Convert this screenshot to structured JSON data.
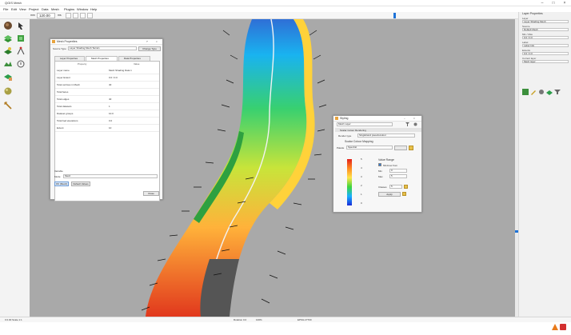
{
  "window": {
    "title": "QGIS Mesh"
  },
  "menu": [
    "File",
    "Edit",
    "View",
    "Project",
    "Data",
    "Mesh",
    "Plugins",
    "Window",
    "Help"
  ],
  "toolbar": {
    "value": "120.00",
    "left_label": "mm",
    "unit_label": "ms"
  },
  "right_panel": {
    "title": "Layer Properties",
    "fields": [
      {
        "label": "Layer",
        "value": "Layer Shading Mesh"
      },
      {
        "label": "Source",
        "value": "Default Mesh"
      },
      {
        "label": "Min / Max",
        "value": "0.0 / 0.0"
      },
      {
        "label": "Label",
        "value": "Label Info"
      },
      {
        "label": "Extents",
        "value": "0.0 / 0.0"
      },
      {
        "label": "Current layer",
        "value": "Mesh layer"
      }
    ]
  },
  "properties_dialog": {
    "title": "Mesh Properties",
    "source_label": "Source Type",
    "source_value": "Layer Shading Mesh Terrain",
    "change_button": "Change Type",
    "tabs": [
      "Layer Properties",
      "Mesh Properties",
      "Data Properties"
    ],
    "col_property": "Property",
    "col_value": "Value",
    "rows": [
      {
        "k": "Layer name",
        "v": "Mesh Shading Data 1"
      },
      {
        "k": "Layer Extent",
        "v": "0.0 / 0.0"
      },
      {
        "k": "Total vertices in Mesh",
        "v": "40"
      },
      {
        "k": "Total faces",
        "v": ""
      },
      {
        "k": "Total edges",
        "v": "40"
      },
      {
        "k": "Total datasets",
        "v": "1"
      },
      {
        "k": "Dataset groups",
        "v": "10.0"
      },
      {
        "k": "Total bed elevations",
        "v": "0.0"
      },
      {
        "k": "Extent",
        "v": "10"
      }
    ],
    "bottom_label": "Variable",
    "mode_label": "Mode",
    "mode_value": "Mesh",
    "btn_ok": "OK (Mesh)",
    "btn_cancel": "Default Values",
    "btn_close": "Close"
  },
  "styling_dialog": {
    "title": "Styling",
    "layer_value": "Mesh Layer",
    "section_title": "Scalar Colour Rendering",
    "type_label": "Render type",
    "type_value": "Singleband pseudocolour",
    "heading": "Scalar Colour Mapping",
    "ramp_label": "Palette",
    "ramp_value": "Spectral",
    "range_title": "Value Range",
    "min_check_label": "Min/max from",
    "min_label": "Min",
    "min_value": "0",
    "max_label": "Max",
    "max_value": "5",
    "classes_label": "Classes",
    "classes_value": "5",
    "apply_button": "Apply",
    "ticks": [
      "5",
      "4",
      "3",
      "2",
      "1",
      "0"
    ],
    "colors": [
      "#e3201c",
      "#ff8a1f",
      "#ffe34a",
      "#3dd63d",
      "#17b0ff",
      "#1b2bd8"
    ]
  },
  "status": {
    "coordinate": "0 0.00 Scale 1:1",
    "rotation": "Rotation 0.0",
    "magnifier": "100%",
    "crs": "EPSG:27700"
  }
}
